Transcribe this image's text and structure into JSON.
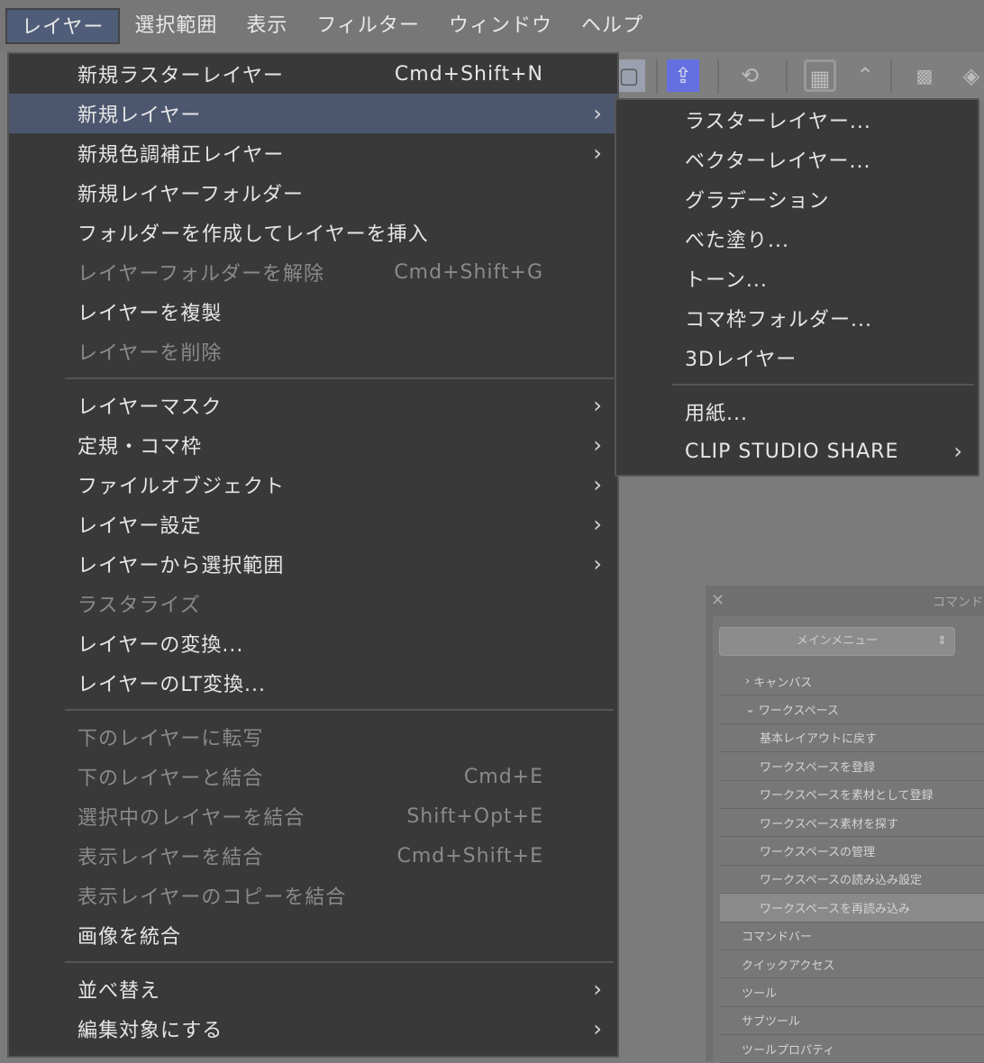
{
  "menubar": [
    "レイヤー",
    "選択範囲",
    "表示",
    "フィルター",
    "ウィンドウ",
    "ヘルプ"
  ],
  "toolbar_icons": [
    "document-icon",
    "share-icon",
    "symmetry-icon",
    "grid-icon",
    "up-down-icon",
    "pattern-icon",
    "layers-icon"
  ],
  "accent": "#6470e0",
  "main_menu": [
    {
      "label": "新規ラスターレイヤー",
      "shortcut": "Cmd+Shift+N"
    },
    {
      "label": "新規レイヤー",
      "submenu": true,
      "highlighted": true
    },
    {
      "label": "新規色調補正レイヤー",
      "submenu": true
    },
    {
      "label": "新規レイヤーフォルダー"
    },
    {
      "label": "フォルダーを作成してレイヤーを挿入"
    },
    {
      "label": "レイヤーフォルダーを解除",
      "shortcut": "Cmd+Shift+G",
      "disabled": true
    },
    {
      "label": "レイヤーを複製"
    },
    {
      "label": "レイヤーを削除",
      "disabled": true
    },
    {
      "separator": true
    },
    {
      "label": "レイヤーマスク",
      "submenu": true
    },
    {
      "label": "定規・コマ枠",
      "submenu": true
    },
    {
      "label": "ファイルオブジェクト",
      "submenu": true
    },
    {
      "label": "レイヤー設定",
      "submenu": true
    },
    {
      "label": "レイヤーから選択範囲",
      "submenu": true
    },
    {
      "label": "ラスタライズ",
      "disabled": true
    },
    {
      "label": "レイヤーの変換..."
    },
    {
      "label": "レイヤーのLT変換..."
    },
    {
      "separator": true
    },
    {
      "label": "下のレイヤーに転写",
      "disabled": true
    },
    {
      "label": "下のレイヤーと結合",
      "shortcut": "Cmd+E",
      "disabled": true
    },
    {
      "label": "選択中のレイヤーを結合",
      "shortcut": "Shift+Opt+E",
      "disabled": true
    },
    {
      "label": "表示レイヤーを結合",
      "shortcut": "Cmd+Shift+E",
      "disabled": true
    },
    {
      "label": "表示レイヤーのコピーを結合",
      "disabled": true
    },
    {
      "label": "画像を統合"
    },
    {
      "separator": true
    },
    {
      "label": "並べ替え",
      "submenu": true
    },
    {
      "label": "編集対象にする",
      "submenu": true
    }
  ],
  "sub_menu": [
    {
      "label": "ラスターレイヤー..."
    },
    {
      "label": "ベクターレイヤー..."
    },
    {
      "label": "グラデーション"
    },
    {
      "label": "べた塗り..."
    },
    {
      "label": "トーン..."
    },
    {
      "label": "コマ枠フォルダー..."
    },
    {
      "label": "3Dレイヤー"
    },
    {
      "separator": true
    },
    {
      "label": "用紙..."
    },
    {
      "label": "CLIP STUDIO SHARE",
      "submenu": true
    }
  ],
  "command_panel": {
    "title": "コマンド",
    "select": "メインメニュー",
    "items": [
      {
        "label": "キャンバス",
        "indent": 1,
        "collapsed": true
      },
      {
        "label": "ワークスペース",
        "indent": 1,
        "expanded": true
      },
      {
        "label": "基本レイアウトに戻す",
        "indent": 2
      },
      {
        "label": "ワークスペースを登録",
        "indent": 2
      },
      {
        "label": "ワークスペースを素材として登録",
        "indent": 2
      },
      {
        "label": "ワークスペース素材を探す",
        "indent": 2
      },
      {
        "label": "ワークスペースの管理",
        "indent": 2
      },
      {
        "label": "ワークスペースの読み込み設定",
        "indent": 2
      },
      {
        "label": "ワークスペースを再読み込み",
        "indent": 2,
        "selected": true
      },
      {
        "label": "コマンドバー",
        "indent": 0
      },
      {
        "label": "クイックアクセス",
        "indent": 0
      },
      {
        "label": "ツール",
        "indent": 0
      },
      {
        "label": "サブツール",
        "indent": 0
      },
      {
        "label": "ツールプロパティ",
        "indent": 0
      }
    ]
  }
}
